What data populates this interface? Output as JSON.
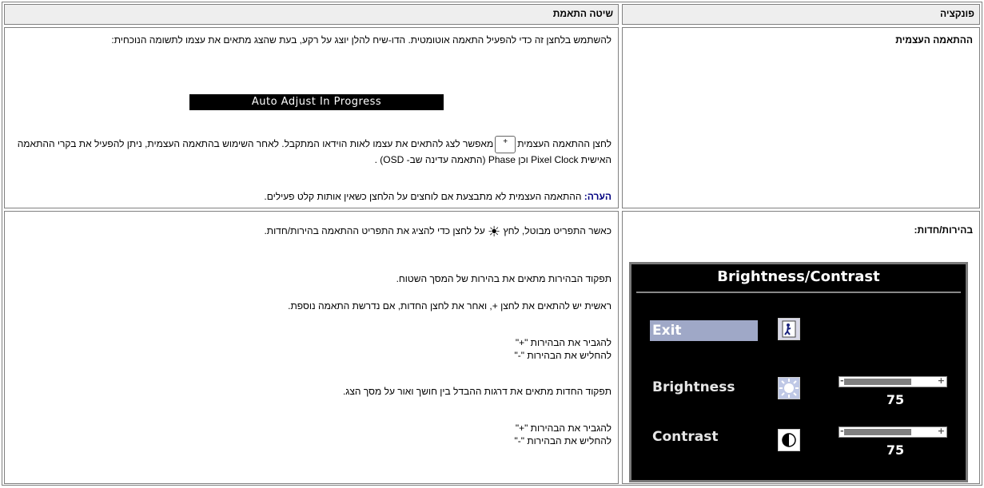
{
  "headers": {
    "method": "שיטה התאמת",
    "function": "פונקציה"
  },
  "auto": {
    "name": "ההתאמה העצמית",
    "para1": "להשתמש בלחצן זה כדי להפעיל התאמה אוטומטית. הדו-שיח להלן יוצג על רקע, בעת שהצג מתאים את עצמו לתשומה הנוכחית:",
    "bar_text": "Auto Adjust In Progress",
    "para2_before": "לחצן ההתאמה העצמית",
    "para2_after": "מאפשר לצג להתאים את עצמו לאות הוידאו המתקבל. לאחר השימוש בהתאמה העצמית, ניתן להפעיל את בקרי ההתאמה האישית Pixel Clock וכן Phase (התאמה עדינה שב- OSD) .",
    "note_label": "הערה:",
    "note_text": "ההתאמה העצמית לא מתבצעת אם לוחצים על הלחצן כשאין אותות קלט פעילים."
  },
  "brightness": {
    "name": "בהירות/חדות:",
    "para1_before": "כאשר התפריט מבוטל, לחץ",
    "para1_after": "על לחצן כדי להציג את התפריט ההתאמה בהירות/חדות.",
    "para2": "תפקוד הבהירות מתאים את בהירות של המסך השטוח.",
    "para3": "ראשית יש להתאים את לחצן +, ואחר את לחצן החדות, אם נדרשת התאמה נוספת.",
    "inc1": "להגביר את הבהירות \"+\"",
    "dec1": "להחליש את הבהירות \"-\"",
    "para4": "תפקוד החדות מתאים את דרגות ההבדל בין חושך ואור על מסך הצג.",
    "inc2": "להגביר את הבהירות \"+\"",
    "dec2": "להחליש את הבהירות \"-\""
  },
  "osd": {
    "title": "Brightness/Contrast",
    "exit": "Exit",
    "brightness_label": "Brightness",
    "contrast_label": "Contrast",
    "brightness_value": "75",
    "contrast_value": "75",
    "brightness_level": 0.75,
    "contrast_level": 0.75,
    "minus": "-",
    "plus": "+"
  }
}
